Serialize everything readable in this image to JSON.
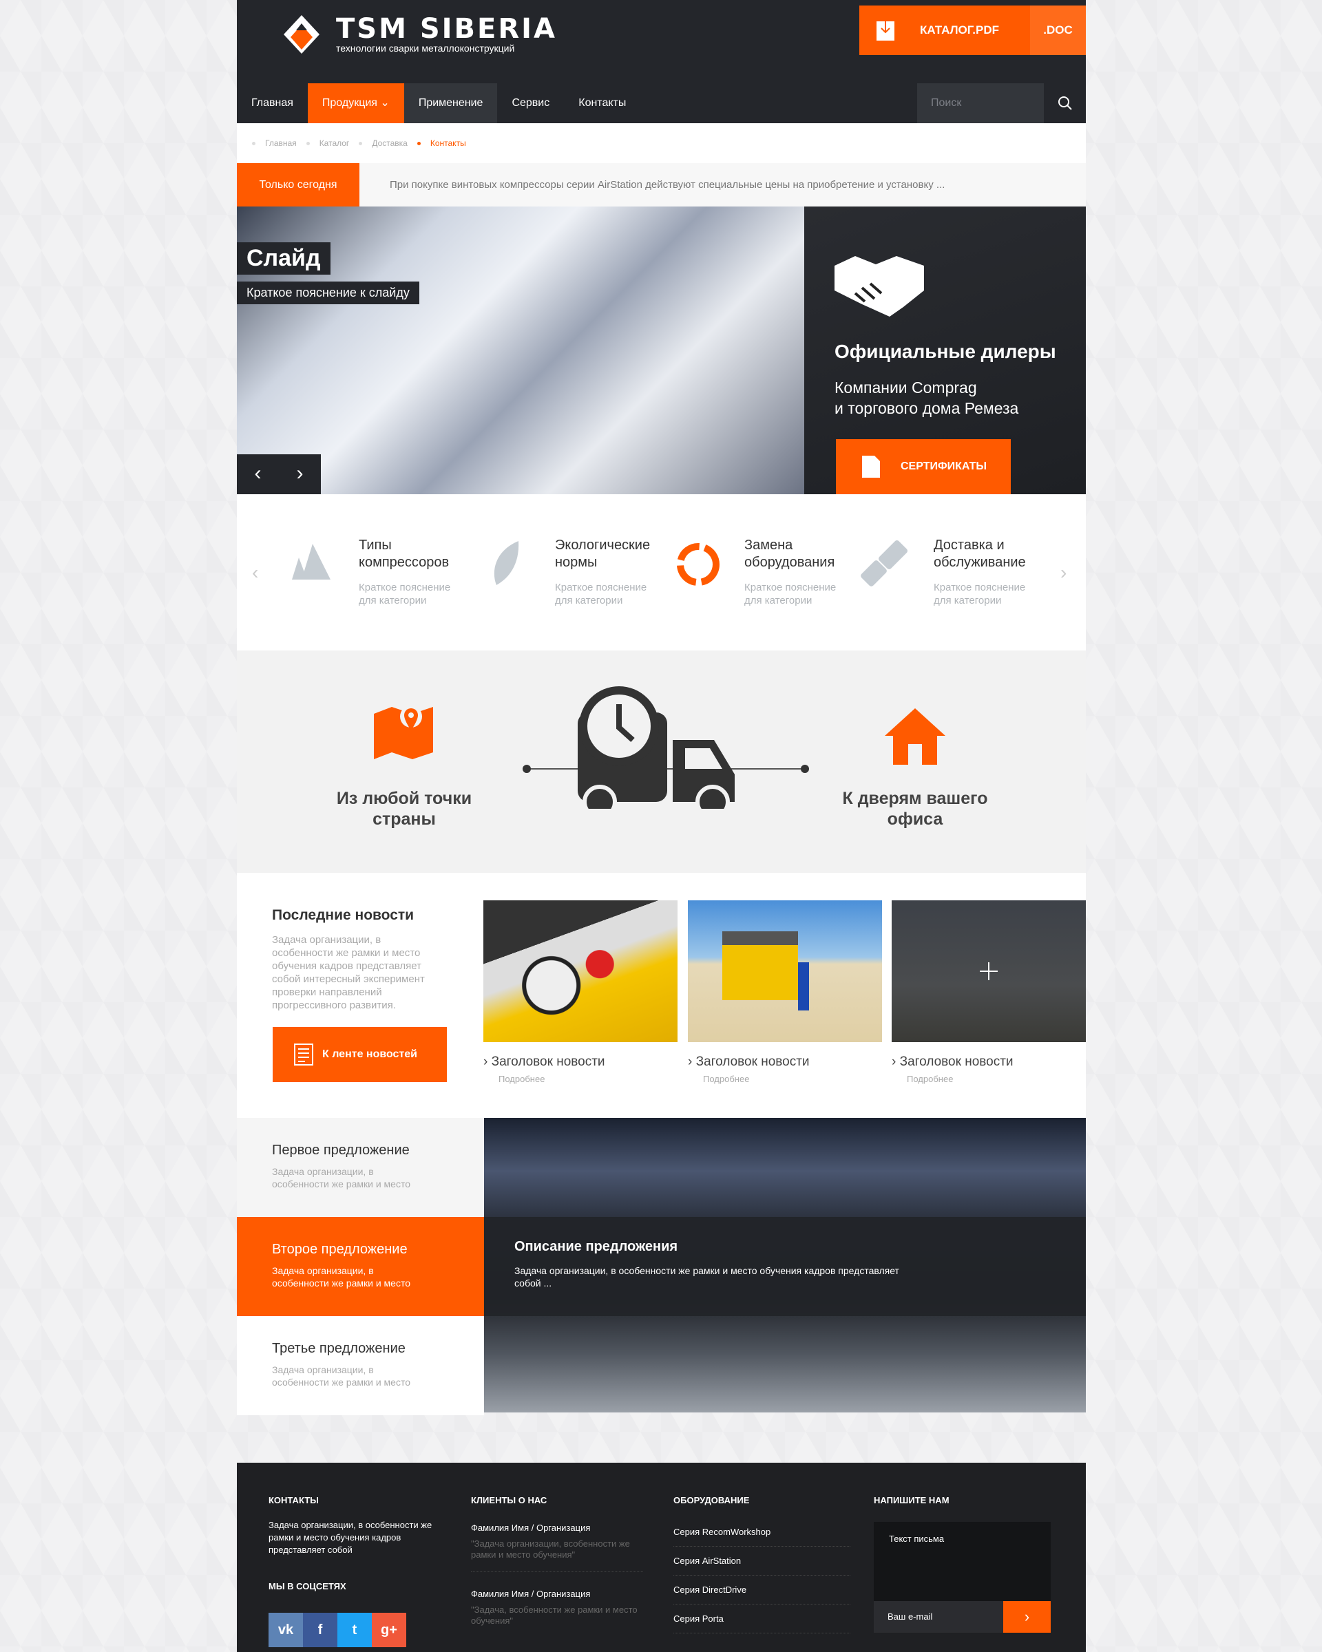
{
  "header": {
    "brand": "TSM SIBERIA",
    "tagline": "технологии сварки металлоконструкций",
    "catalog_pdf": "КАТАЛОГ.PDF",
    "catalog_doc": ".DOC"
  },
  "nav": {
    "items": [
      "Главная",
      "Продукция",
      "Применение",
      "Сервис",
      "Контакты"
    ],
    "search_placeholder": "Поиск"
  },
  "breadcrumb": [
    "Главная",
    "Каталог",
    "Доставка",
    "Контакты"
  ],
  "promo": {
    "label": "Только сегодня",
    "text": "При покупке винтовых компрессоры серии AirStation действуют специальные цены на приобретение и установку ..."
  },
  "slider": {
    "title": "Слайд",
    "caption": "Краткое пояснение к слайду",
    "prev": "‹",
    "next": "›"
  },
  "dealers": {
    "title": "Официальные дилеры",
    "line1": "Компании Comprag",
    "line2": "и торгового дома Ремеза",
    "button": "СЕРТИФИКАТЫ"
  },
  "categories": [
    {
      "title": "Типы компрессоров",
      "desc": "Краткое пояснение для категории",
      "icon": "mountain-icon"
    },
    {
      "title": "Экологические нормы",
      "desc": "Краткое пояснение для категории",
      "icon": "leaf-icon"
    },
    {
      "title": "Замена оборудования",
      "desc": "Краткое пояснение для категории",
      "icon": "refresh-icon"
    },
    {
      "title": "Доставка и обслуживание",
      "desc": "Краткое пояснение для категории",
      "icon": "plug-icon"
    }
  ],
  "delivery": {
    "left": "Из любой точки страны",
    "right": "К дверям вашего офиса"
  },
  "news": {
    "title": "Последние новости",
    "desc": "Задача организации, в особенности же рамки и место обучения кадров представляет собой интересный эксперимент проверки направлений прогрессивного развития.",
    "button": "К ленте новостей",
    "items": [
      {
        "title": "Заголовок новости",
        "more": "Подробнее"
      },
      {
        "title": "Заголовок новости",
        "more": "Подробнее"
      },
      {
        "title": "Заголовок новости",
        "more": "Подробнее"
      }
    ]
  },
  "offers": {
    "items": [
      {
        "title": "Первое предложение",
        "desc": "Задача организации, в особенности же рамки и место"
      },
      {
        "title": "Второе предложение",
        "desc": "Задача организации, в особенности же рамки и место"
      },
      {
        "title": "Третье предложение",
        "desc": "Задача организации, в особенности же рамки и место"
      }
    ],
    "detail_title": "Описание предложения",
    "detail_text": "Задача организации, в особенности же рамки и место обучения кадров представляет собой ..."
  },
  "footer": {
    "contacts_h": "КОНТАКТЫ",
    "contacts_text": "Задача организации, в особенности же рамки и место обучения кадров представляет собой",
    "social_h": "МЫ В СОЦСЕТЯХ",
    "social": [
      {
        "label": "vk",
        "color": "#5d83b5"
      },
      {
        "label": "f",
        "color": "#3b5998"
      },
      {
        "label": "t",
        "color": "#1da1f2"
      },
      {
        "label": "g+",
        "color": "#f0583a"
      }
    ],
    "clients_h": "КЛИЕНТЫ О НАС",
    "clients": [
      {
        "name": "Фамилия Имя / Организация",
        "quote": "\"Задача организации, всобенности же рамки и место обучения\""
      },
      {
        "name": "Фамилия Имя / Организация",
        "quote": "\"Задача, всобенности же рамки и место обучения\""
      }
    ],
    "equipment_h": "ОБОРУДОВАНИЕ",
    "equipment": [
      "Серия RecomWorkshop",
      "Серия AirStation",
      "Серия DirectDrive",
      "Серия Porta"
    ],
    "write_h": "НАПИШИТЕ НАМ",
    "message_placeholder": "Текст письма",
    "email_placeholder": "Ваш e-mail",
    "send": "›"
  },
  "colors": {
    "accent": "#ff5a00",
    "dark": "#24262b"
  }
}
